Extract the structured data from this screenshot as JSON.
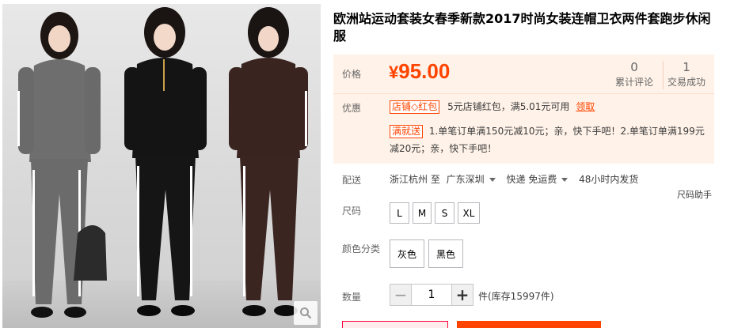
{
  "product": {
    "title": "欧洲站运动套装女春季新款2017时尚女装连帽卫衣两件套跑步休闲服"
  },
  "price": {
    "label": "价格",
    "currency": "¥",
    "amount": "95.00"
  },
  "stats": [
    {
      "value": "0",
      "label": "累计评论"
    },
    {
      "value": "1",
      "label": "交易成功"
    }
  ],
  "promo": {
    "label": "优惠",
    "items": [
      {
        "tag": "店铺◇红包",
        "text": "5元店铺红包，满5.01元可用",
        "link": "领取"
      },
      {
        "tag": "满就送",
        "text": "1.单笔订单满150元减10元；亲，快下手吧！2.单笔订单满199元减20元；亲，快下手吧！"
      }
    ]
  },
  "shipping": {
    "label": "配送",
    "from": "浙江杭州 至",
    "to": "广东深圳",
    "method": "快递 免运费",
    "dispatch": "48小时内发货"
  },
  "size_help": "尺码助手",
  "size": {
    "label": "尺码",
    "options": [
      "L",
      "M",
      "S",
      "XL"
    ]
  },
  "color": {
    "label": "颜色分类",
    "options": [
      "灰色",
      "黑色"
    ]
  },
  "quantity": {
    "label": "数量",
    "value": "1",
    "minus": "−",
    "plus": "+",
    "stock_text": "件(库存15997件)"
  },
  "colors": {
    "accent": "#ff4400",
    "price_bg": "#fff2e8"
  }
}
